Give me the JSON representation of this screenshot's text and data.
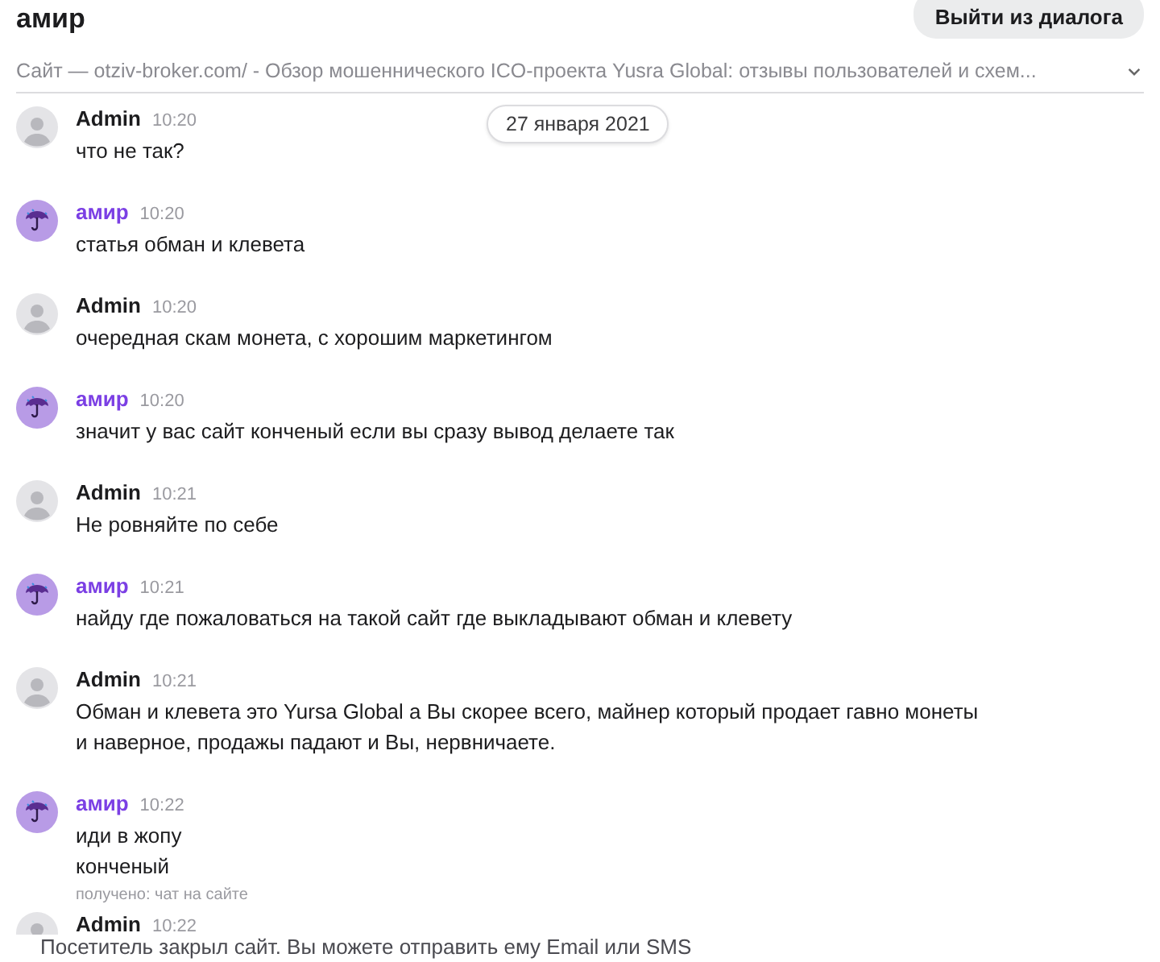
{
  "header": {
    "title": "амир",
    "exit_button": "Выйти из диалога"
  },
  "subject": {
    "text": "Сайт — otziv-broker.com/ - Обзор мошеннического ICO-проекта Yusra Global: отзывы пользователей и схем...",
    "expanded": false
  },
  "date_badge": "27 января 2021",
  "messages": [
    {
      "kind": "admin",
      "author": "Admin",
      "time": "10:20",
      "lines": [
        "что не так?"
      ]
    },
    {
      "kind": "visitor",
      "author": "амир",
      "time": "10:20",
      "lines": [
        "статья обман и клевета"
      ]
    },
    {
      "kind": "admin",
      "author": "Admin",
      "time": "10:20",
      "lines": [
        "очередная скам монета, с хорошим маркетингом"
      ]
    },
    {
      "kind": "visitor",
      "author": "амир",
      "time": "10:20",
      "lines": [
        "значит у вас сайт конченый если вы сразу вывод делаете так"
      ]
    },
    {
      "kind": "admin",
      "author": "Admin",
      "time": "10:21",
      "lines": [
        "Не ровняйте по себе"
      ]
    },
    {
      "kind": "visitor",
      "author": "амир",
      "time": "10:21",
      "lines": [
        "найду где пожаловаться на такой сайт где выкладывают обман и клевету"
      ]
    },
    {
      "kind": "admin",
      "author": "Admin",
      "time": "10:21",
      "lines": [
        "Обман и клевета это Yursa Global а Вы скорее всего, майнер который продает гавно монеты",
        "и наверное, продажы падают и Вы, нервничаете."
      ]
    },
    {
      "kind": "visitor",
      "author": "амир",
      "time": "10:22",
      "lines": [
        "иди в жопу",
        "конченый"
      ],
      "note": "получено: чат на сайте"
    },
    {
      "kind": "admin",
      "author": "Admin",
      "time": "10:22"
    }
  ],
  "footer_notice": "Посетитель закрыл сайт. Вы можете отправить ему Email или SMS"
}
